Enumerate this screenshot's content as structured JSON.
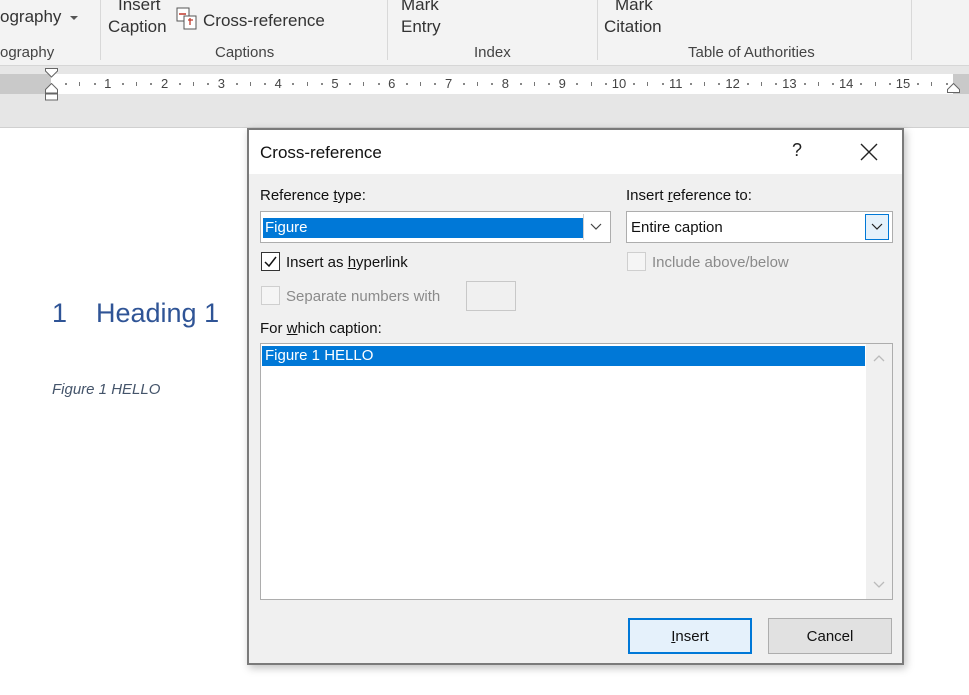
{
  "ribbon": {
    "bibliography_fragment": "ography",
    "bibliography_group_fragment": "ography",
    "insert_caption_line1": "Insert",
    "insert_caption_line2": "Caption",
    "cross_reference": "Cross-reference",
    "captions_group": "Captions",
    "mark_entry_line1": "Mark",
    "mark_entry_line2": "Entry",
    "index_group": "Index",
    "mark_citation_line1": "Mark",
    "mark_citation_line2": "Citation",
    "toa_group": "Table of Authorities"
  },
  "ruler": {
    "numbers": [
      "1",
      "2",
      "3",
      "4",
      "5",
      "6",
      "7",
      "8",
      "9",
      "10",
      "11",
      "12",
      "13",
      "14",
      "15"
    ]
  },
  "document": {
    "heading_number": "1",
    "heading_text": "Heading 1",
    "caption": "Figure 1 HELLO"
  },
  "dialog": {
    "title": "Cross-reference",
    "help": "?",
    "reference_type": {
      "label_pre": "Reference ",
      "label_u": "t",
      "label_post": "ype:",
      "value": "Figure"
    },
    "insert_reference_to": {
      "label_pre": "Insert ",
      "label_u": "r",
      "label_post": "eference to:",
      "value": "Entire caption"
    },
    "insert_as_hyperlink": {
      "label_pre": "Insert as ",
      "label_u": "h",
      "label_post": "yperlink",
      "checked": true
    },
    "include_above_below": {
      "label": "Include above/below",
      "checked": false,
      "enabled": false
    },
    "separate_numbers": {
      "label": "Separate numbers with",
      "checked": false,
      "enabled": false
    },
    "for_which_caption": {
      "label_pre": "For ",
      "label_u": "w",
      "label_post": "hich caption:"
    },
    "captions": [
      "Figure 1 HELLO"
    ],
    "insert_button": {
      "label_u": "I",
      "label_post": "nsert"
    },
    "cancel_button": "Cancel"
  },
  "colors": {
    "accent": "#0078d7",
    "heading": "#2f5496",
    "caption": "#44546a"
  }
}
